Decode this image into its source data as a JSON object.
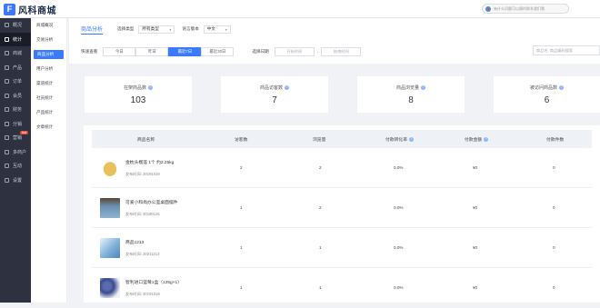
{
  "header": {
    "logo_text": "风科商城",
    "notice_text": "有什么问题可以随时联系我们哦"
  },
  "sidebar": {
    "items": [
      {
        "label": "概况",
        "icon": "home-icon",
        "active": false
      },
      {
        "label": "统计",
        "icon": "chart-icon",
        "active": true
      },
      {
        "label": "商城",
        "icon": "shop-icon",
        "active": false
      },
      {
        "label": "产品",
        "icon": "box-icon",
        "active": false
      },
      {
        "label": "订单",
        "icon": "order-icon",
        "active": false
      },
      {
        "label": "会员",
        "icon": "user-icon",
        "active": false
      },
      {
        "label": "财务",
        "icon": "wallet-icon",
        "active": false
      },
      {
        "label": "分销",
        "icon": "share-icon",
        "active": false
      },
      {
        "label": "营销",
        "icon": "megaphone-icon",
        "active": false,
        "badge": "hot"
      },
      {
        "label": "多商户",
        "icon": "store-icon",
        "active": false
      },
      {
        "label": "互动",
        "icon": "chat-icon",
        "active": false
      },
      {
        "label": "设置",
        "icon": "gear-icon",
        "active": false
      }
    ]
  },
  "subnav": {
    "items": [
      {
        "label": "商城概况",
        "active": false
      },
      {
        "label": "交易分析",
        "active": false
      },
      {
        "label": "商品分析",
        "active": true
      },
      {
        "label": "用户分析",
        "active": false
      },
      {
        "label": "渠道统计",
        "active": false
      },
      {
        "label": "社员统计",
        "active": false
      },
      {
        "label": "产品统计",
        "active": false
      },
      {
        "label": "文章统计",
        "active": false
      }
    ]
  },
  "filters": {
    "tab": "商品分析",
    "type_label": "选择类型",
    "type_value": "所有类型",
    "lang_label": "语言版本",
    "lang_value": "中文",
    "quick_label": "快速查看",
    "quick_buttons": [
      {
        "label": "今日",
        "active": false
      },
      {
        "label": "昨日",
        "active": false
      },
      {
        "label": "最近7日",
        "active": true
      },
      {
        "label": "最近30日",
        "active": false
      }
    ],
    "date_label": "选择日期",
    "start_placeholder": "开始时间",
    "end_placeholder": "结束时间",
    "date_separator": "-",
    "search_placeholder": "商品名, 商品编码搜索"
  },
  "stats": [
    {
      "label": "在架商品数",
      "value": "103"
    },
    {
      "label": "商品访客数",
      "value": "7"
    },
    {
      "label": "商品浏览量",
      "value": "8"
    },
    {
      "label": "被访问商品数",
      "value": "6"
    }
  ],
  "table": {
    "columns": [
      {
        "label": "商品名称",
        "help": false
      },
      {
        "label": "访客数",
        "help": false
      },
      {
        "label": "浏览量",
        "help": false
      },
      {
        "label": "付款转化率",
        "help": true
      },
      {
        "label": "付款金额",
        "help": true
      },
      {
        "label": "付款件数",
        "help": false
      }
    ],
    "date_prefix": "发布时间",
    "rows": [
      {
        "name": "金枕头榴莲 1个 约2.25kg",
        "date": "20191019",
        "visitors": "2",
        "views": "2",
        "conversion": "0.0%",
        "amount": "¥0",
        "qty": "0",
        "thumb": "#e8c15a"
      },
      {
        "name": "可爱小和尚办公室桌面摆件",
        "date": "20190125",
        "visitors": "1",
        "views": "2",
        "conversion": "0.0%",
        "amount": "¥0",
        "qty": "0",
        "thumb": "#6b8fb0"
      },
      {
        "name": "商品1213",
        "date": "20211213",
        "visitors": "1",
        "views": "1",
        "conversion": "0.0%",
        "amount": "¥0",
        "qty": "0",
        "thumb": "#7fb0d8"
      },
      {
        "name": "智利进口蓝莓1盒（125g×1）",
        "date": "20191019",
        "visitors": "1",
        "views": "1",
        "conversion": "0.0%",
        "amount": "¥0",
        "qty": "0",
        "thumb": "#3b4a8c"
      }
    ]
  }
}
